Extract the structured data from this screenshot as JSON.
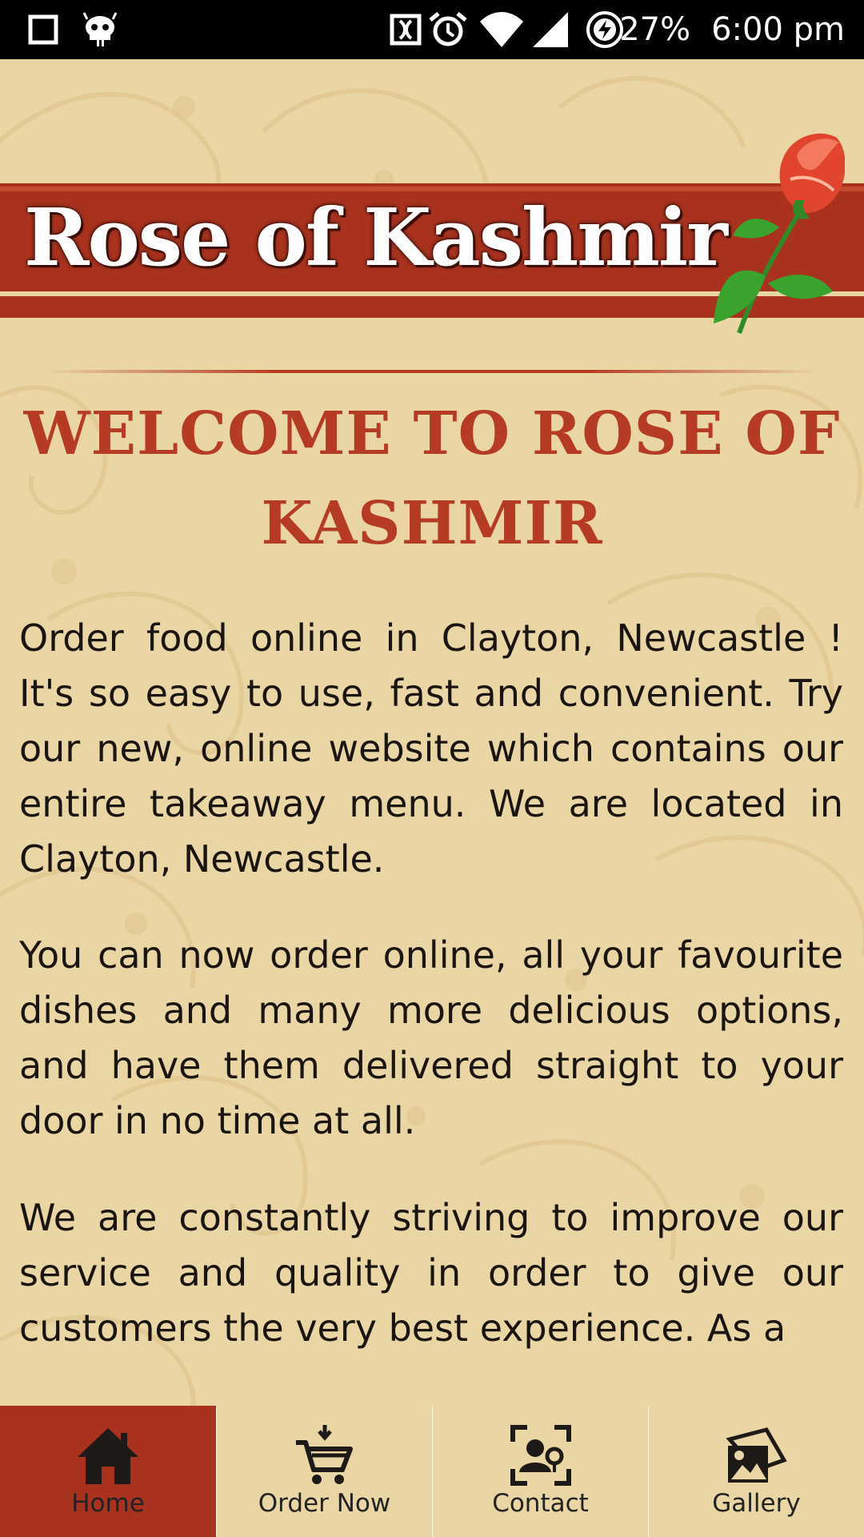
{
  "status_bar": {
    "left_icons": [
      "stop-square-icon",
      "android-debug-icon"
    ],
    "right_icons": [
      "nfc-icon",
      "alarm-icon",
      "wifi-icon",
      "cell-signal-icon",
      "battery-charging-icon"
    ],
    "battery": "27%",
    "time": "6:00 pm"
  },
  "header": {
    "logo_text": "Rose of Kashmir",
    "logo_icon": "rose-icon"
  },
  "main": {
    "title": "Welcome to Rose of Kashmir",
    "paragraphs": [
      "Order food online in Clayton, Newcastle ! It's so easy to use, fast and convenient. Try our new, online website which contains our entire takeaway menu. We are located in Clayton, Newcastle.",
      "You can now order online, all your favourite dishes and many more delicious options, and have them delivered straight to your door in no time at all.",
      "We are constantly striving to improve our service and quality in order to give our customers the very best experience. As a"
    ]
  },
  "bottom_nav": {
    "items": [
      {
        "label": "Home",
        "icon": "home-icon",
        "active": true
      },
      {
        "label": "Order Now",
        "icon": "cart-icon",
        "active": false
      },
      {
        "label": "Contact",
        "icon": "contact-icon",
        "active": false
      },
      {
        "label": "Gallery",
        "icon": "gallery-icon",
        "active": false
      }
    ]
  },
  "colors": {
    "brand_red": "#a9321f",
    "title_red": "#b63b25",
    "background": "#ead6a4",
    "status_bar": "#000000"
  }
}
